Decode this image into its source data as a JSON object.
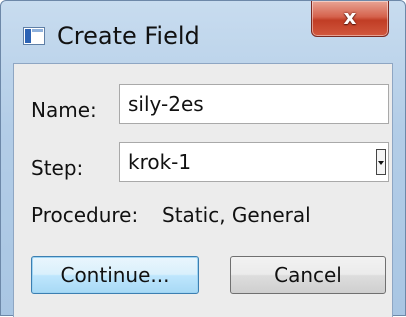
{
  "window": {
    "title": "Create Field",
    "close_label": "x"
  },
  "form": {
    "name_label": "Name:",
    "name_value": "sily-2es",
    "step_label": "Step:",
    "step_value": "krok-1",
    "procedure_label": "Procedure:",
    "procedure_value": "Static, General"
  },
  "buttons": {
    "continue_label": "Continue...",
    "cancel_label": "Cancel"
  },
  "icons": {
    "app": "window-icon",
    "close": "close-icon",
    "dropdown": "chevron-down-icon"
  }
}
